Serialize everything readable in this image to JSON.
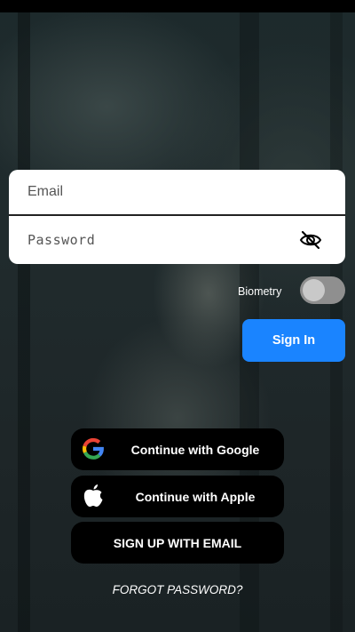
{
  "login": {
    "email_placeholder": "Email",
    "password_placeholder": "Password",
    "password_visibility_icon": "eye-off-icon"
  },
  "biometry": {
    "label": "Biometry",
    "enabled": false
  },
  "buttons": {
    "sign_in": "Sign In",
    "google": "Continue with Google",
    "apple": "Continue with Apple",
    "email_signup": "SIGN UP WITH EMAIL",
    "forgot_password": "FORGOT PASSWORD?"
  },
  "colors": {
    "primary_button": "#1a84ff",
    "social_button": "#000000",
    "card": "#ffffff"
  }
}
